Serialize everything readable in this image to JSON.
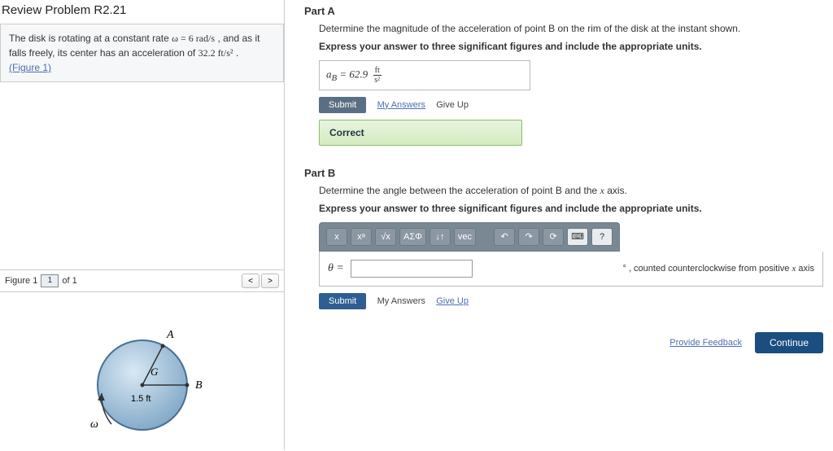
{
  "title": "Review Problem R2.21",
  "problem": {
    "text_before_omega": "The disk is rotating at a constant rate ",
    "omega": "ω = 6 rad/s",
    "text_mid": " , and as it falls freely, its center has an acceleration of ",
    "accel": "32.2 ft/s²",
    "text_after": " .",
    "figure_link": "(Figure 1)"
  },
  "figure_bar": {
    "label": "Figure 1",
    "selector": "1",
    "of_text": "of 1",
    "prev": "<",
    "next": ">"
  },
  "figure": {
    "A": "A",
    "B": "B",
    "G": "G",
    "radius": "1.5 ft",
    "omega": "ω"
  },
  "partA": {
    "head": "Part A",
    "desc": "Determine the magnitude of the acceleration of point B on the rim of the disk at the instant shown.",
    "instr": "Express your answer to three significant figures and include the appropriate units.",
    "answer_prefix": "a",
    "answer_sub": "B",
    "answer_eq": " = ",
    "answer_val": "62.9",
    "answer_units_top": "ft",
    "answer_units_bot": "s²",
    "submit": "Submit",
    "myanswers": "My Answers",
    "giveup": "Give Up",
    "correct": "Correct"
  },
  "partB": {
    "head": "Part B",
    "desc_before": "Determine the angle between the acceleration of point B and the ",
    "desc_var": "x",
    "desc_after": " axis.",
    "instr": "Express your answer to three significant figures and include the appropriate units.",
    "toolbar": {
      "t1": "x",
      "t2": "xᵃ",
      "t3": "√x",
      "t4": "ΑΣΦ",
      "t5": "↓↑",
      "t6": "vec",
      "t7": "↶",
      "t8": "↷",
      "t9": "⟳",
      "t10": "⌨",
      "t11": "?"
    },
    "theta": "θ =",
    "input_value": "",
    "unit_symbol": "°",
    "unit_text": " , counted counterclockwise from positive ",
    "unit_var": "x",
    "unit_after": " axis",
    "submit": "Submit",
    "myanswers": "My Answers",
    "giveup": "Give Up"
  },
  "footer": {
    "feedback": "Provide Feedback",
    "continue": "Continue"
  }
}
